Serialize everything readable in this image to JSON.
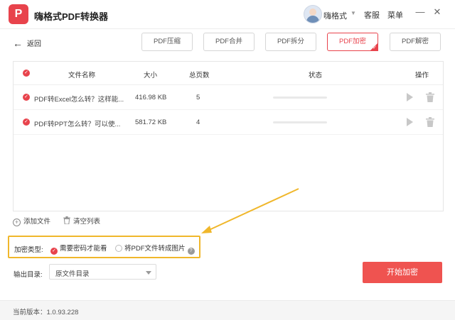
{
  "window": {
    "title": "嗨格式PDF转换器",
    "logo_glyph": "P",
    "user_name": "嗨格式",
    "links": [
      "客服",
      "菜单"
    ],
    "controls": {
      "minimize": "—",
      "maximize": "☐",
      "close": "✕"
    }
  },
  "nav": {
    "back_label": "返回",
    "tabs": [
      {
        "label": "PDF压缩",
        "active": false
      },
      {
        "label": "PDF合并",
        "active": false
      },
      {
        "label": "PDF拆分",
        "active": false
      },
      {
        "label": "PDF加密",
        "active": true
      },
      {
        "label": "PDF解密",
        "active": false
      }
    ]
  },
  "table": {
    "headers": {
      "name": "文件名称",
      "size": "大小",
      "pages": "总页数",
      "status": "状态",
      "actions": "操作"
    },
    "rows": [
      {
        "name": "PDF转Excel怎么转？这样能...",
        "size": "416.98 KB",
        "pages": "5",
        "progress": 0
      },
      {
        "name": "PDF转PPT怎么转？可以使...",
        "size": "581.72 KB",
        "pages": "4",
        "progress": 0
      }
    ]
  },
  "file_actions": {
    "add": "添加文件",
    "clear": "清空列表"
  },
  "encryption": {
    "label": "加密类型:",
    "options": [
      {
        "label": "需要密码才能看",
        "selected": true
      },
      {
        "label": "将PDF文件转成图片",
        "selected": false
      }
    ]
  },
  "output": {
    "label": "输出目录:",
    "value": "原文件目录"
  },
  "start_button": "开始加密",
  "footer": {
    "version": "当前版本：1.0.93.228"
  },
  "colors": {
    "accent": "#e8434c",
    "highlight": "#f0b72b",
    "start_button": "#ef5350"
  },
  "icons": {
    "back": "arrow-left-icon",
    "play": "play-icon",
    "delete": "trash-icon",
    "add": "plus-circle-icon",
    "clear": "trash-icon",
    "help": "question-icon"
  }
}
